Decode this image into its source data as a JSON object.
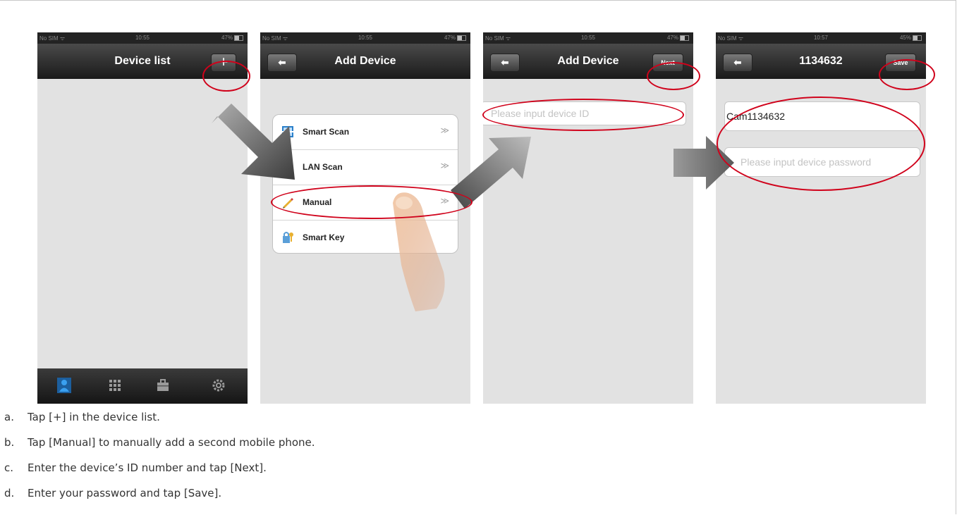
{
  "screens": [
    {
      "status": {
        "carrier": "No SIM ᯤ",
        "time": "10:55",
        "battery": "47%"
      },
      "title": "Device list",
      "action_label": "+",
      "tabs": [
        "contacts-icon",
        "grid-icon",
        "toolbox-icon",
        "gear-icon"
      ]
    },
    {
      "status": {
        "carrier": "No SIM ᯤ",
        "time": "10:55",
        "battery": "47%"
      },
      "title": "Add Device",
      "menu": [
        {
          "label": "Smart Scan",
          "chevron": "≫",
          "icon": "scan-icon"
        },
        {
          "label": "LAN Scan",
          "chevron": "≫",
          "icon": "lan-icon"
        },
        {
          "label": "Manual",
          "chevron": "≫",
          "icon": "pencil-icon"
        },
        {
          "label": "Smart Key",
          "chevron": "",
          "icon": "key-icon"
        }
      ]
    },
    {
      "status": {
        "carrier": "No SIM ᯤ",
        "time": "10:55",
        "battery": "47%"
      },
      "title": "Add Device",
      "action_label": "Next",
      "device_id_placeholder": "Please input device ID"
    },
    {
      "status": {
        "carrier": "No SIM ᯤ",
        "time": "10:57",
        "battery": "45%"
      },
      "title": "1134632",
      "action_label": "Save",
      "name_value": "Cam1134632",
      "password_placeholder": "Please input device password"
    }
  ],
  "highlight_color": "#d0021b",
  "steps": [
    {
      "marker": "a.",
      "text": "Tap [+] in the device list."
    },
    {
      "marker": "b.",
      "text": "Tap [Manual] to manually add a second mobile phone."
    },
    {
      "marker": "c.",
      "text": "Enter the device’s ID number and tap [Next]."
    },
    {
      "marker": "d.",
      "text": "Enter your password and tap [Save]."
    }
  ]
}
